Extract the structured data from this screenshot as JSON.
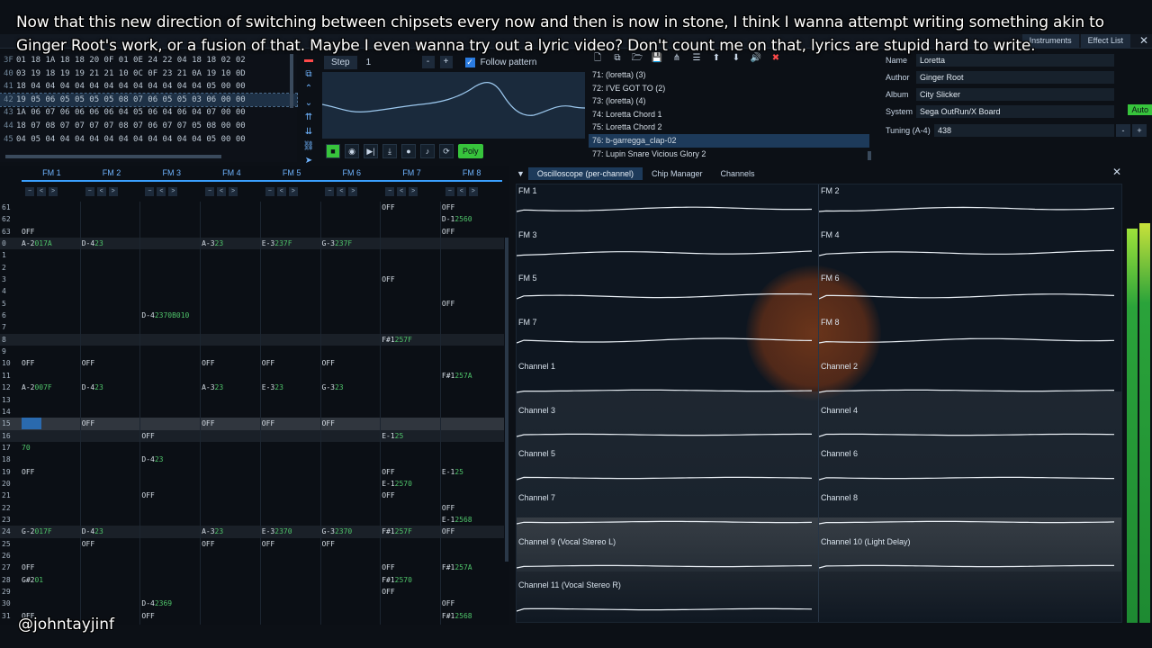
{
  "caption": "Now that this new direction of switching between chipsets every now and then is now in stone, I think I wanna attempt writing something akin to Ginger Root's work, or a fusion of that. Maybe I even wanna try out a lyric video? Don't count me on that, lyrics are stupid hard to write.",
  "handle": "@johntayjinf",
  "window_tabs": [
    "Instruments",
    "Effect List"
  ],
  "orders": {
    "rows": [
      {
        "n": "3F",
        "cells": "01 18 1A 18 18 20 0F 01 0E 24 22 04 18 18 02 02"
      },
      {
        "n": "40",
        "cells": "03 19 18 19 19 21 21 10 0C 0F 23 21 0A 19 10 0D"
      },
      {
        "n": "41",
        "cells": "18 04 04 04 04 04 04 04 04 04 04 04 04 05 00 00"
      },
      {
        "n": "42",
        "cells": "19 05 06 05 05 05 05 08 07 06 05 05 03 06 00 00"
      },
      {
        "n": "43",
        "cells": "1A 06 07 06 06 06 06 04 05 06 04 06 04 07 00 00"
      },
      {
        "n": "44",
        "cells": "18 07 08 07 07 07 07 08 07 06 07 07 05 08 00 00"
      },
      {
        "n": "45",
        "cells": "04 05 04 04 04 04 04 04 04 04 04 04 04 05 00 00"
      }
    ],
    "selected": 3
  },
  "step": {
    "label": "Step",
    "value": "1",
    "minus": "-",
    "plus": "+",
    "follow_label": "Follow pattern",
    "follow_checked": true
  },
  "transport": {
    "poly_label": "Poly"
  },
  "instruments": [
    "71: (loretta) (3)",
    "72: I'VE GOT TO (2)",
    "73: (loretta) (4)",
    "74: Loretta Chord 1",
    "75: Loretta Chord 2",
    "76: b-garregga_clap-02",
    "77: Lupin Snare Vicious Glory 2"
  ],
  "instruments_selected": 5,
  "song": {
    "name_label": "Name",
    "name": "Loretta",
    "author_label": "Author",
    "author": "Ginger Root",
    "album_label": "Album",
    "album": "City Slicker",
    "system_label": "System",
    "system": "Sega OutRun/X Board",
    "auto_label": "Auto",
    "tuning_label": "Tuning (A-4)",
    "tuning": "438",
    "minus": "-",
    "plus": "+"
  },
  "pattern": {
    "channels": [
      "FM 1",
      "FM 2",
      "FM 3",
      "FM 4",
      "FM 5",
      "FM 6",
      "FM 7",
      "FM 8"
    ],
    "rows": [
      {
        "n": "61",
        "cells": [
          {
            "c": 6,
            "t": "OFF"
          },
          {
            "c": 7,
            "t": "OFF"
          }
        ]
      },
      {
        "n": "62",
        "cells": [
          {
            "c": 7,
            "t": "D-1",
            "i": "2560"
          }
        ]
      },
      {
        "n": "63",
        "cells": [
          {
            "c": 0,
            "t": "OFF"
          },
          {
            "c": 7,
            "t": "OFF"
          }
        ]
      },
      {
        "n": "0",
        "bar": true,
        "cells": [
          {
            "c": 0,
            "t": "A-2",
            "i": "017A"
          },
          {
            "c": 1,
            "t": "D-4",
            "i": "23"
          },
          {
            "c": 3,
            "t": "A-3",
            "i": "23"
          },
          {
            "c": 4,
            "t": "E-3",
            "i": "237F"
          },
          {
            "c": 5,
            "t": "G-3",
            "i": "237F"
          }
        ]
      },
      {
        "n": "1",
        "cells": []
      },
      {
        "n": "2",
        "cells": []
      },
      {
        "n": "3",
        "cells": [
          {
            "c": 6,
            "t": "OFF"
          }
        ]
      },
      {
        "n": "4",
        "cells": []
      },
      {
        "n": "5",
        "cells": [
          {
            "c": 7,
            "t": "OFF"
          }
        ]
      },
      {
        "n": "6",
        "cells": [
          {
            "c": 2,
            "t": "D-4",
            "i": "2370B010"
          }
        ]
      },
      {
        "n": "7",
        "cells": []
      },
      {
        "n": "8",
        "bar": true,
        "cells": [
          {
            "c": 6,
            "t": "F#1",
            "i": "257F"
          }
        ]
      },
      {
        "n": "9",
        "cells": []
      },
      {
        "n": "10",
        "cells": [
          {
            "c": 0,
            "t": "OFF"
          },
          {
            "c": 1,
            "t": "OFF"
          },
          {
            "c": 3,
            "t": "OFF"
          },
          {
            "c": 4,
            "t": "OFF"
          },
          {
            "c": 5,
            "t": "OFF"
          }
        ]
      },
      {
        "n": "11",
        "cells": [
          {
            "c": 7,
            "t": "F#1",
            "i": "257A"
          }
        ]
      },
      {
        "n": "12",
        "cells": [
          {
            "c": 0,
            "t": "A-2",
            "i": "007F"
          },
          {
            "c": 1,
            "t": "D-4",
            "i": "23"
          },
          {
            "c": 3,
            "t": "A-3",
            "i": "23"
          },
          {
            "c": 4,
            "t": "E-3",
            "i": "23"
          },
          {
            "c": 5,
            "t": "G-3",
            "i": "23"
          }
        ]
      },
      {
        "n": "13",
        "cells": []
      },
      {
        "n": "14",
        "cells": []
      },
      {
        "n": "15",
        "cur": true,
        "cells": [
          {
            "c": 1,
            "t": "OFF"
          },
          {
            "c": 3,
            "t": "OFF"
          },
          {
            "c": 4,
            "t": "OFF"
          },
          {
            "c": 5,
            "t": "OFF"
          }
        ]
      },
      {
        "n": "16",
        "bar": true,
        "cells": [
          {
            "c": 2,
            "t": "OFF"
          },
          {
            "c": 6,
            "t": "E-1",
            "i": "25"
          }
        ]
      },
      {
        "n": "17",
        "cells": [
          {
            "c": 0,
            "t": "",
            "i": "70"
          }
        ]
      },
      {
        "n": "18",
        "cells": [
          {
            "c": 2,
            "t": "D-4",
            "i": "23"
          }
        ]
      },
      {
        "n": "19",
        "cells": [
          {
            "c": 0,
            "t": "OFF"
          },
          {
            "c": 6,
            "t": "OFF"
          },
          {
            "c": 7,
            "t": "E-1",
            "i": "25"
          }
        ]
      },
      {
        "n": "20",
        "cells": [
          {
            "c": 6,
            "t": "E-1",
            "i": "2570"
          }
        ]
      },
      {
        "n": "21",
        "cells": [
          {
            "c": 2,
            "t": "OFF"
          },
          {
            "c": 6,
            "t": "OFF"
          }
        ]
      },
      {
        "n": "22",
        "cells": [
          {
            "c": 7,
            "t": "OFF"
          }
        ]
      },
      {
        "n": "23",
        "cells": [
          {
            "c": 7,
            "t": "E-1",
            "i": "2568"
          }
        ]
      },
      {
        "n": "24",
        "bar": true,
        "cells": [
          {
            "c": 0,
            "t": "G-2",
            "i": "017F"
          },
          {
            "c": 1,
            "t": "D-4",
            "i": "23"
          },
          {
            "c": 3,
            "t": "A-3",
            "i": "23"
          },
          {
            "c": 4,
            "t": "E-3",
            "i": "2370"
          },
          {
            "c": 5,
            "t": "G-3",
            "i": "2370"
          },
          {
            "c": 6,
            "t": "F#1",
            "i": "257F"
          },
          {
            "c": 7,
            "t": "OFF"
          }
        ]
      },
      {
        "n": "25",
        "cells": [
          {
            "c": 1,
            "t": "OFF"
          },
          {
            "c": 3,
            "t": "OFF"
          },
          {
            "c": 4,
            "t": "OFF"
          },
          {
            "c": 5,
            "t": "OFF"
          }
        ]
      },
      {
        "n": "26",
        "cells": []
      },
      {
        "n": "27",
        "cells": [
          {
            "c": 0,
            "t": "OFF"
          },
          {
            "c": 6,
            "t": "OFF"
          },
          {
            "c": 7,
            "t": "F#1",
            "i": "257A"
          }
        ]
      },
      {
        "n": "28",
        "cells": [
          {
            "c": 0,
            "t": "G#2",
            "i": "01"
          },
          {
            "c": 6,
            "t": "F#1",
            "i": "2570"
          }
        ]
      },
      {
        "n": "29",
        "cells": [
          {
            "c": 6,
            "t": "OFF"
          }
        ]
      },
      {
        "n": "30",
        "cells": [
          {
            "c": 2,
            "t": "D-4",
            "i": "2369"
          },
          {
            "c": 7,
            "t": "OFF"
          }
        ]
      },
      {
        "n": "31",
        "cells": [
          {
            "c": 0,
            "t": "OFF"
          },
          {
            "c": 2,
            "t": "OFF"
          },
          {
            "c": 7,
            "t": "F#1",
            "i": "2568"
          }
        ]
      }
    ]
  },
  "osc_tabs": [
    "Oscilloscope (per-channel)",
    "Chip Manager",
    "Channels"
  ],
  "osc_channels": [
    "FM 1",
    "FM 2",
    "FM 3",
    "FM 4",
    "FM 5",
    "FM 6",
    "FM 7",
    "FM 8",
    "Channel 1",
    "Channel 2",
    "Channel 3",
    "Channel 4",
    "Channel 5",
    "Channel 6",
    "Channel 7",
    "Channel 8",
    "Channel 9 (Vocal Stereo L)",
    "Channel 10 (Light Delay)",
    "Channel 11 (Vocal Stereo R)"
  ],
  "colors": {
    "accent": "#3aa0ff",
    "green": "#37c43c",
    "danger": "#ff4a4a"
  }
}
